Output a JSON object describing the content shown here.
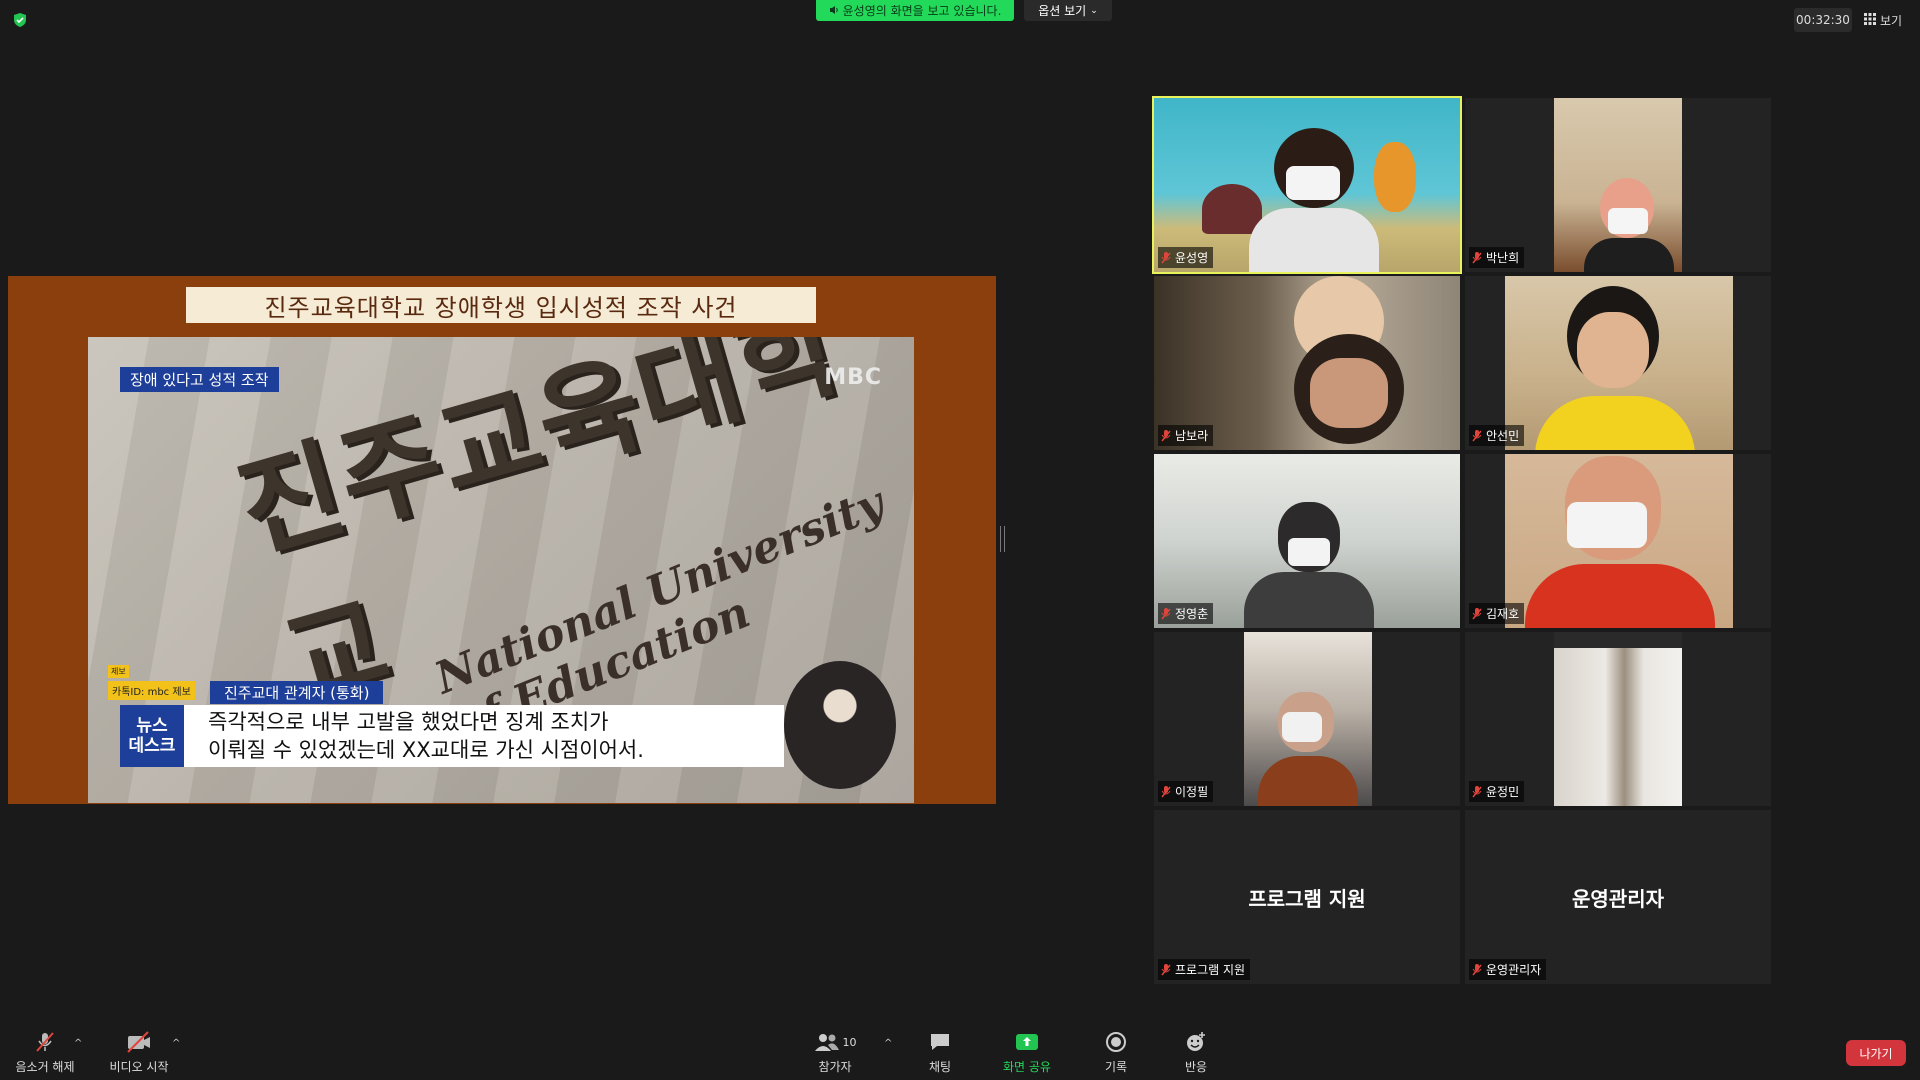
{
  "top_bar": {
    "viewing_text": "윤성영의 화면을 보고 있습니다.",
    "view_options": "옵션 보기",
    "timer": "00:32:30",
    "view_button": "보기"
  },
  "shared_screen": {
    "slide_title": "진주교육대학교 장애학생 입시성적 조작 사건",
    "tag": "장애 있다고 성적 조작",
    "broadcaster": "MBC",
    "building_text": "진주교육대학교",
    "building_text_en": "National University of Education",
    "source_small": "제보",
    "source_label": "카톡ID: mbc 제보",
    "speaker": "진주교대 관계자 (통화)",
    "logo_line1": "뉴스",
    "logo_line2": "데스크",
    "caption_line1": "즉각적으로 내부 고발을 했었다면 징계 조치가",
    "caption_line2": "이뤄질 수 있었겠는데 XX교대로 가신 시점이어서."
  },
  "participants": [
    {
      "name": "윤성영",
      "has_video": true
    },
    {
      "name": "박난희",
      "has_video": true
    },
    {
      "name": "남보라",
      "has_video": true
    },
    {
      "name": "안선민",
      "has_video": true
    },
    {
      "name": "정영춘",
      "has_video": true
    },
    {
      "name": "김재호",
      "has_video": true
    },
    {
      "name": "이정필",
      "has_video": true
    },
    {
      "name": "윤정민",
      "has_video": true
    },
    {
      "name": "프로그램 지원",
      "has_video": false
    },
    {
      "name": "운영관리자",
      "has_video": false
    }
  ],
  "toolbar": {
    "unmute": "음소거 해제",
    "start_video": "비디오 시작",
    "participants_label": "참가자",
    "participants_count": "10",
    "chat": "채팅",
    "share_screen": "화면 공유",
    "record": "기록",
    "reactions": "반응",
    "leave": "나가기"
  },
  "colors": {
    "share_accent": "#23d959",
    "active_speaker": "#e8f25b",
    "leave": "#d3353c",
    "muted": "#e0453b"
  }
}
